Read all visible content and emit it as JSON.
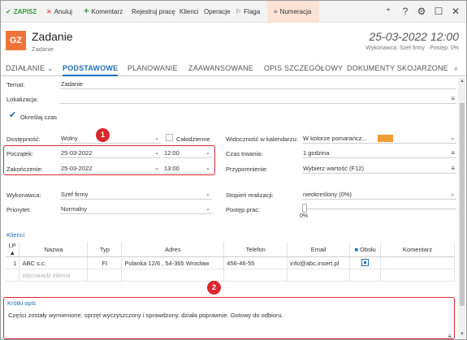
{
  "toolbar": {
    "zapisz": "ZAPISZ",
    "anuluj": "Anuluj",
    "komentarz": "Komentarz",
    "rejestruj": "Rejestruj pracę",
    "klienci": "Klienci",
    "operacje": "Operacje",
    "flaga": "Flaga",
    "numeracja": "Numeracja"
  },
  "header": {
    "badge": "GZ",
    "title": "Zadanie",
    "subtitle": "Zadanie",
    "datetime": "25-03-2022 12:00",
    "wykonawca": "Wykonawca: Szef firmy  ·  Postęp: 0%"
  },
  "tabs": [
    "DZIAŁANIE",
    "PODSTAWOWE",
    "PLANOWANIE",
    "ZAAWANSOWANE",
    "OPIS SZCZEGÓŁOWY",
    "DOKUMENTY SKOJARZONE"
  ],
  "form": {
    "temat_label": "Temat:",
    "temat_value": "Zadanie",
    "lokalizacja_label": "Lokalizacja:",
    "okreslaj_czas": "Określaj czas",
    "dostepnosc_label": "Dostępność:",
    "dostepnosc_value": "Wolny",
    "calodzienne": "Całodzienne",
    "poczatek_label": "Początek:",
    "poczatek_date": "25-03-2022",
    "poczatek_time": "12:00",
    "zakonczenie_label": "Zakończenie:",
    "zakonczenie_date": "25-03-2022",
    "zakonczenie_time": "13:00",
    "widocznosc_label": "Widoczność w kalendarzu:",
    "widocznosc_value": "W kolorze pomarańcz...",
    "czas_trwania_label": "Czas trwania:",
    "czas_trwania_value": "1 godzina",
    "przypomnienie_label": "Przypomnienie:",
    "przypomnienie_value": "Wybierz wartość (F12)",
    "wykonawca_label": "Wykonawca:",
    "wykonawca_value": "Szef firmy",
    "priorytet_label": "Priorytet:",
    "priorytet_value": "Normalny",
    "stopien_label": "Stopień realizacji:",
    "stopien_value": "nieokreślony  (0%)",
    "postep_label": "Postęp prac:",
    "postep_value": "0%",
    "postep_fraction": 0
  },
  "klienci": {
    "title": "Klienci",
    "columns": [
      "LP ▲",
      "Nazwa",
      "Typ",
      "Adres",
      "Telefon",
      "Email",
      "Obsłu",
      "Komentarz"
    ],
    "rows": [
      {
        "lp": "1",
        "nazwa": "ABC s.c.",
        "typ": "FI",
        "adres": "Polanka  12/6 , 54-365 Wrocław",
        "telefon": "456-46-55",
        "email": "info@abc.insert.pl"
      }
    ],
    "placeholder": "Wprowadź klienta"
  },
  "opis": {
    "title": "Krótki opis",
    "text": "Części zostały wymienione, sprzęt wyczyszczony i sprawdzony, działa poprawnie. Gotowy do odbioru."
  },
  "markers": [
    "1",
    "2"
  ],
  "colors": {
    "accent": "#1e6eb7",
    "badge": "#f0733a",
    "red": "#d9282f",
    "orange": "#f39c33",
    "green": "#2e9e3b"
  }
}
